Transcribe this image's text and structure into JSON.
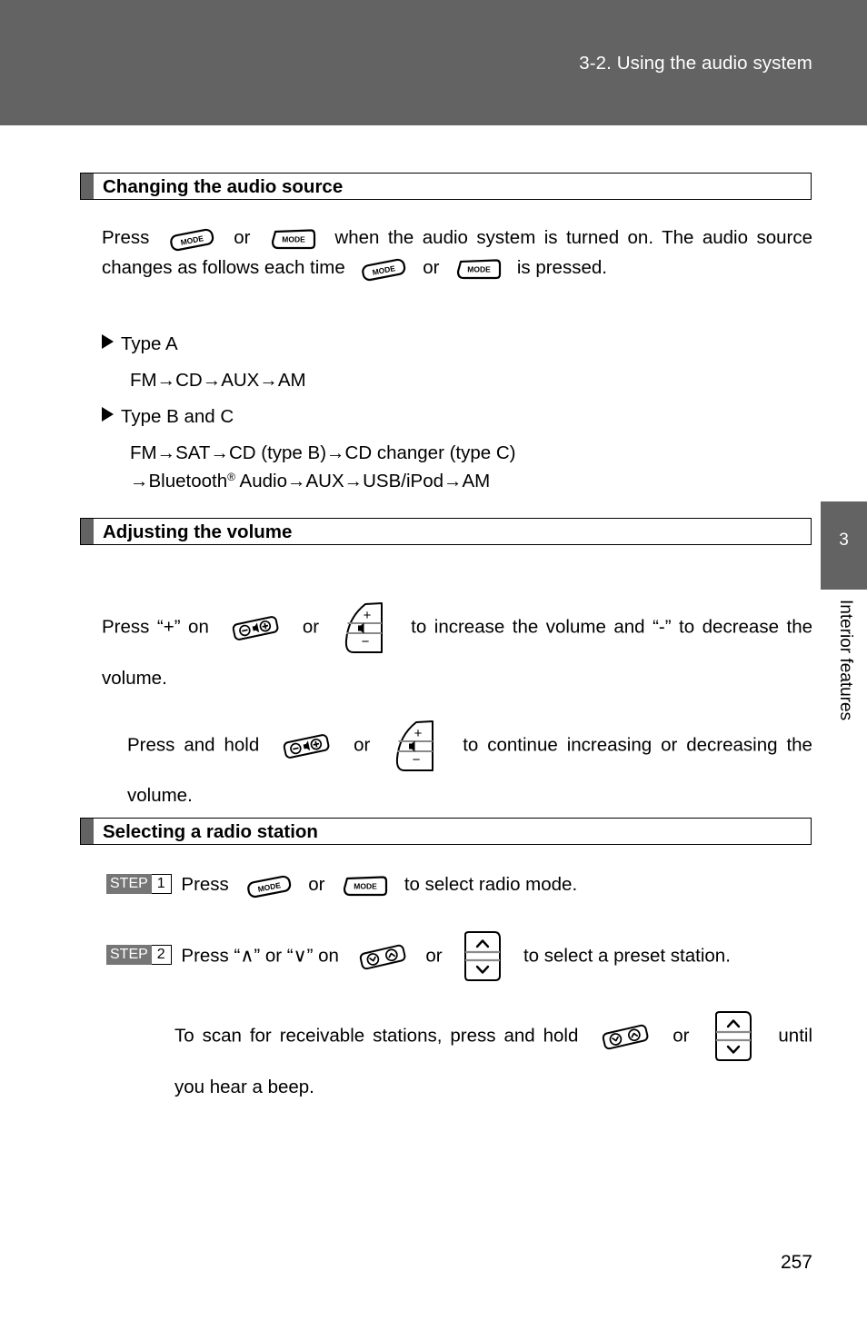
{
  "header": {
    "title": "3-2. Using the audio system"
  },
  "chapter_tab": {
    "number": "3",
    "label": "Interior features"
  },
  "sections": [
    {
      "id": "changing-audio-source",
      "title": "Changing the audio source",
      "paragraph_parts": {
        "p1_a": "Press",
        "p1_b": "or",
        "p1_c": "when the audio system is turned on. The audio source changes as follows each time",
        "p1_d": "or",
        "p1_e": "is pressed."
      },
      "lists": [
        {
          "bullet_label": "Type A",
          "chain": "FM→CD→AUX→AM"
        },
        {
          "bullet_label": "Type B and C",
          "chain_line1": "FM→SAT→CD (type B)→CD changer (type C)",
          "chain_line2_pre": "→Bluetooth",
          "chain_line2_sup": "®",
          "chain_line2_post": " Audio→AUX→USB/iPod→AM"
        }
      ]
    },
    {
      "id": "adjusting-the-volume",
      "title": "Adjusting the volume",
      "paragraph_parts": {
        "p1_a": "Press “+” on",
        "p1_b": "or",
        "p1_c": "to increase the volume and “-” to decrease the volume.",
        "p2_a": "Press and hold",
        "p2_b": "or",
        "p2_c": "to continue increasing or decreasing the volume."
      }
    },
    {
      "id": "selecting-a-radio-station",
      "title": "Selecting a radio station",
      "steps": [
        {
          "badge_word": "STEP",
          "badge_number": "1",
          "text_a": "Press",
          "text_b": "or",
          "text_c": "to select radio mode."
        },
        {
          "badge_word": "STEP",
          "badge_number": "2",
          "text_a": "Press “∧” or “∨” on",
          "text_b": "or",
          "text_c": "to select a preset station."
        }
      ],
      "note": {
        "text_a": "To scan for receivable stations, press and hold",
        "text_b": "or",
        "text_c": "until you hear a beep."
      }
    }
  ],
  "icons": {
    "mode_slanted": "mode-button-slanted-icon",
    "mode_upright": "mode-button-upright-icon",
    "volume_slanted": "volume-rocker-slanted-icon",
    "volume_panel": "volume-steering-panel-icon",
    "seek_slanted": "seek-rocker-slanted-icon",
    "seek_panel": "seek-steering-panel-icon",
    "mode_label": "MODE",
    "plus_label": "+",
    "minus_label": "−"
  },
  "footer": {
    "page_number": "257"
  }
}
